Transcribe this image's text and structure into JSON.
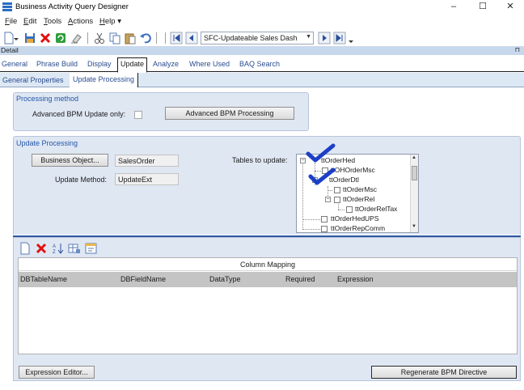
{
  "window": {
    "title": "Business Activity Query Designer",
    "minimize": "–",
    "maximize": "☐",
    "close": "✕"
  },
  "menu": {
    "file": {
      "hot": "F",
      "rest": "ile"
    },
    "edit": {
      "hot": "E",
      "rest": "dit"
    },
    "tools": {
      "hot": "T",
      "rest": "ools"
    },
    "actions": {
      "hot": "A",
      "rest": "ctions"
    },
    "help": {
      "hot": "H",
      "rest": "elp"
    },
    "help_arrow": "▾"
  },
  "toolbar": {
    "dashboard_combo": "SFC-Updateable Sales Dash",
    "combo_arrow": "▼"
  },
  "detail": {
    "label": "Detail",
    "pin": "⊓"
  },
  "tabs": [
    "General",
    "Phrase Build",
    "Display",
    "Update",
    "Analyze",
    "Where Used",
    "BAQ Search"
  ],
  "subtabs": [
    "General Properties",
    "Update Processing"
  ],
  "processing_method": {
    "title": "Processing method",
    "advanced_label": "Advanced BPM Update only:",
    "advanced_button": "Advanced BPM Processing"
  },
  "update_processing": {
    "title": "Update Processing",
    "business_object_button": "Business Object...",
    "business_object_value": "SalesOrder",
    "update_method_label": "Update Method:",
    "update_method_value": "UpdateExt",
    "tables_label": "Tables to update:",
    "tree": [
      {
        "label": "ttOrderHed"
      },
      {
        "label": "ttOHOrderMsc"
      },
      {
        "label": "ttOrderDtl"
      },
      {
        "label": "ttOrderMsc"
      },
      {
        "label": "ttOrderRel"
      },
      {
        "label": "ttOrderRelTax"
      },
      {
        "label": "ttOrderHedUPS"
      },
      {
        "label": "ttOrderRepComm"
      }
    ],
    "tree_scroll_up": "▲",
    "tree_scroll_down": "▼",
    "tree_expander": "−"
  },
  "mapping": {
    "caption": "Column Mapping",
    "columns": [
      "DBTableName",
      "DBFieldName",
      "DataType",
      "Required",
      "Expression"
    ],
    "expression_editor_button": "Expression Editor...",
    "regenerate_button": "Regenerate BPM Directive"
  },
  "colors": {
    "accent": "#2356a8",
    "tab_strip": "#dde8f5",
    "group_bg": "#dfe7f3",
    "check_mark": "#1c3fc8",
    "delete_red": "#e01010"
  }
}
